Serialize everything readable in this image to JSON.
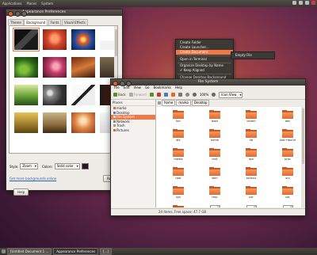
{
  "top_panel": {
    "menus": [
      "Applications",
      "Places",
      "System"
    ]
  },
  "bottom_panel": {
    "tasks": [
      "[Untitled Document 1 ...",
      "Appearance Preferences",
      "[...]"
    ]
  },
  "appearance": {
    "title": "Appearance Preferences",
    "tabs": [
      "Theme",
      "Background",
      "Fonts",
      "Visual Effects"
    ],
    "selected_tab": "Background",
    "style_label": "Style:",
    "style_value": "Zoom",
    "colors_label": "Colors:",
    "colors_value": "Solid color",
    "get_more_link": "Get more backgrounds online",
    "remove_button": "Remove",
    "help_button": "Help"
  },
  "context_menu": {
    "items": [
      "Create Folder",
      "Create Launcher...",
      "Create Document",
      "Open in Terminal",
      "Organize Desktop by Name",
      "Keep Aligned",
      "Change Desktop Background"
    ],
    "highlighted": "Create Document",
    "submenu": [
      "Empty File"
    ]
  },
  "file_manager": {
    "title": "File System",
    "menubar": [
      "File",
      "Edit",
      "View",
      "Go",
      "Bookmarks",
      "Help"
    ],
    "toolbar": {
      "back": "Back",
      "forward": "Forward",
      "zoom": "100%",
      "view": "Icon View"
    },
    "sidebar_header": "Places",
    "sidebar_items": [
      "marko",
      "Desktop",
      "File System",
      "Network",
      "Trash",
      "Pictures"
    ],
    "selected_place": "File System",
    "path": [
      "home",
      "marko",
      "Desktop"
    ],
    "files": [
      {
        "name": "bin",
        "kind": "folder"
      },
      {
        "name": "boot",
        "kind": "folder"
      },
      {
        "name": "cdrom",
        "kind": "folder"
      },
      {
        "name": "dev",
        "kind": "folder"
      },
      {
        "name": "etc",
        "kind": "folder"
      },
      {
        "name": "home",
        "kind": "folder"
      },
      {
        "name": "lib",
        "kind": "folder"
      },
      {
        "name": "lost+found",
        "kind": "folder"
      },
      {
        "name": "media",
        "kind": "folder"
      },
      {
        "name": "mnt",
        "kind": "folder"
      },
      {
        "name": "opt",
        "kind": "folder"
      },
      {
        "name": "proc",
        "kind": "folder"
      },
      {
        "name": "root",
        "kind": "folder"
      },
      {
        "name": "sbin",
        "kind": "folder"
      },
      {
        "name": "selinux",
        "kind": "folder"
      },
      {
        "name": "srv",
        "kind": "folder"
      },
      {
        "name": "sys",
        "kind": "folder"
      },
      {
        "name": "tmp",
        "kind": "folder"
      },
      {
        "name": "usr",
        "kind": "folder"
      },
      {
        "name": "var",
        "kind": "folder"
      },
      {
        "name": "",
        "kind": "folder"
      },
      {
        "name": "",
        "kind": "doc"
      },
      {
        "name": "",
        "kind": "doc"
      },
      {
        "name": "",
        "kind": "doc"
      }
    ],
    "status": "24 items, Free space: 47.7 GB"
  },
  "colors": {
    "accent": "#f07746",
    "folder": "#e26a2f",
    "panel": "#3d3a36"
  }
}
